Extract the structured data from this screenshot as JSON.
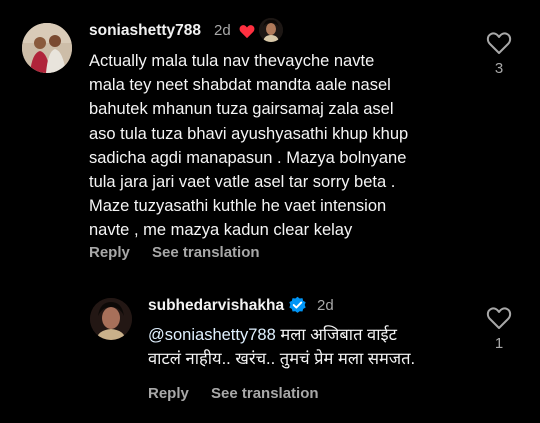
{
  "comment": {
    "username": "soniashetty788",
    "time": "2d",
    "text_lines": [
      "Actually mala tula nav thevayche navte",
      "mala tey neet shabdat mandta aale nasel",
      "bahutek mhanun tuza gairsamaj zala asel",
      "aso tula tuza bhavi ayushyasathi khup khup",
      "sadicha agdi manapasun . Mazya bolnyane",
      "tula jara jari vaet vatle asel tar sorry beta .",
      "Maze tuzyasathi kuthle he vaet intension",
      "navte , me mazya kadun clear kelay"
    ],
    "like_count": "3",
    "reply_label": "Reply",
    "translate_label": "See translation",
    "liked_by_creator_icon": "heart-icon",
    "heart_color": "#ff3040"
  },
  "reply": {
    "username": "subhedarvishakha",
    "time": "2d",
    "mention": "@soniashetty788",
    "line1_rest": " मला अजिबात वाईट",
    "line2": "वाटलं नाहीय.. खरंच.. तुमचं प्रेम मला समजत.",
    "like_count": "1",
    "reply_label": "Reply",
    "translate_label": "See translation",
    "verified_icon": "verified-badge-icon",
    "verified_color": "#0095f6"
  },
  "colors": {
    "background": "#000000",
    "text": "#f5f5f5",
    "secondary": "#a8a8a8"
  }
}
